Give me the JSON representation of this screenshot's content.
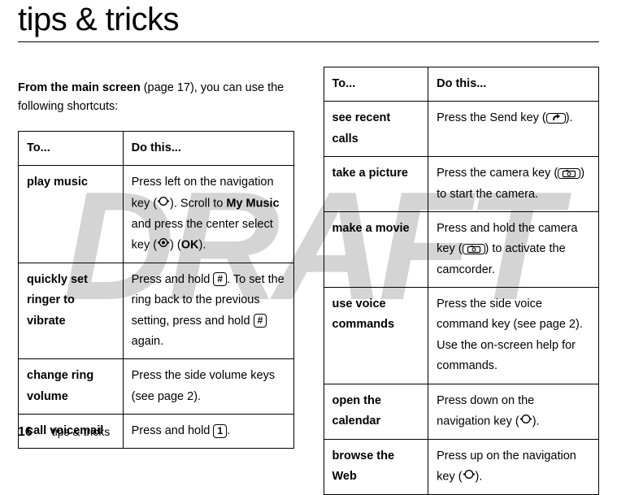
{
  "watermark": "DRAFT",
  "title": "tips & tricks",
  "intro": {
    "lead_bold": "From the main screen",
    "lead_rest": " (page 17), you can use the following shortcuts:"
  },
  "table_headers": {
    "to": "To...",
    "do": "Do this..."
  },
  "left_rows": [
    {
      "action": "play music",
      "do_parts": {
        "a": "Press left on the navigation key (",
        "b": "). Scroll to ",
        "menu": "My Music",
        "c": " and press the center select key (",
        "d": ") (",
        "ok": "OK",
        "e": ")."
      }
    },
    {
      "action": "quickly set ringer to vibrate",
      "do_parts": {
        "a": "Press and hold ",
        "key1": "#",
        "b": ". To set the ring back to the previous setting, press and hold ",
        "key2": "#",
        "c": " again."
      }
    },
    {
      "action": "change ring volume",
      "do_text": "Press the side volume keys (see page 2)."
    },
    {
      "action": "call voicemail",
      "do_parts": {
        "a": "Press and hold ",
        "key1": "1",
        "b": "."
      }
    }
  ],
  "right_rows": [
    {
      "action": "see recent calls",
      "do_parts": {
        "a": "Press the Send key (",
        "b": ")."
      }
    },
    {
      "action": "take a picture",
      "do_parts": {
        "a": "Press the camera key (",
        "b": ") to start the camera."
      }
    },
    {
      "action": "make a movie",
      "do_parts": {
        "a": "Press and hold the camera key (",
        "b": ") to activate the camcorder."
      }
    },
    {
      "action": "use voice commands",
      "do_text": "Press the side voice command key (see page 2). Use the on-screen help for commands."
    },
    {
      "action": "open the calendar",
      "do_parts": {
        "a": "Press down on the navigation key (",
        "b": ")."
      }
    },
    {
      "action": "browse the Web",
      "do_parts": {
        "a": "Press up on the navigation key (",
        "b": ")."
      }
    }
  ],
  "footer": {
    "page": "16",
    "section": "tips & tricks"
  }
}
